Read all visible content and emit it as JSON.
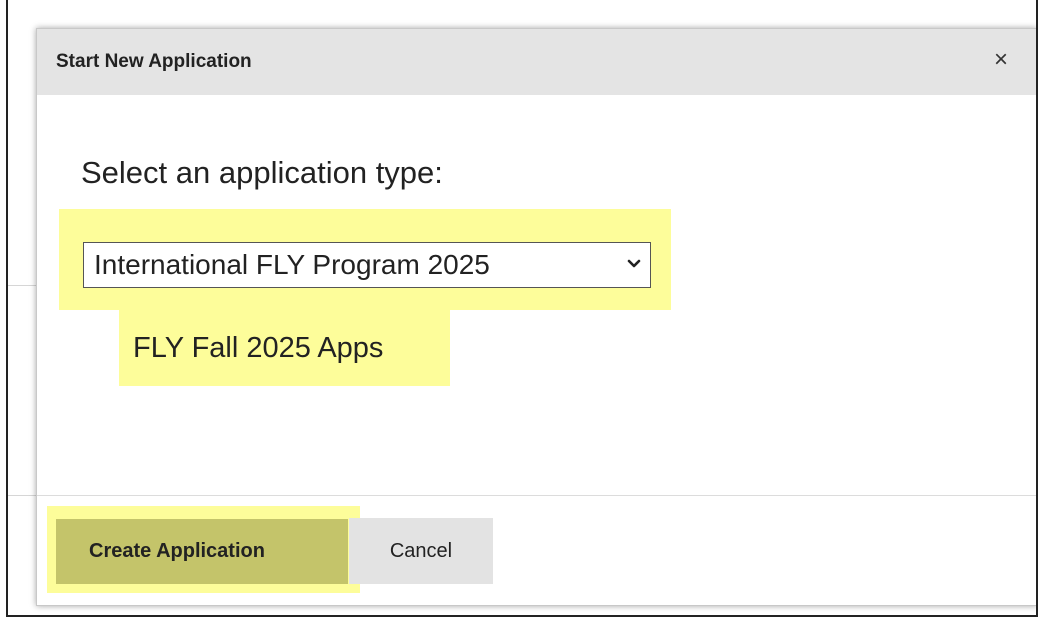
{
  "modal": {
    "title": "Start New Application",
    "close_glyph": "×",
    "close_icon": "close-icon",
    "prompt": "Select an application type:",
    "select": {
      "selected_value": "International FLY Program 2025",
      "chevron_icon": "chevron-down-icon",
      "chevron_glyph": "⌄"
    },
    "option_label": "FLY Fall 2025 Apps",
    "buttons": {
      "create_label": "Create Application",
      "cancel_label": "Cancel"
    }
  },
  "colors": {
    "highlight": "#fdfd9a",
    "header_bg": "#e4e4e4",
    "primary_button": "#c4c46a",
    "secondary_button": "#e3e3e3",
    "background_heading": "#8b1a1a"
  }
}
